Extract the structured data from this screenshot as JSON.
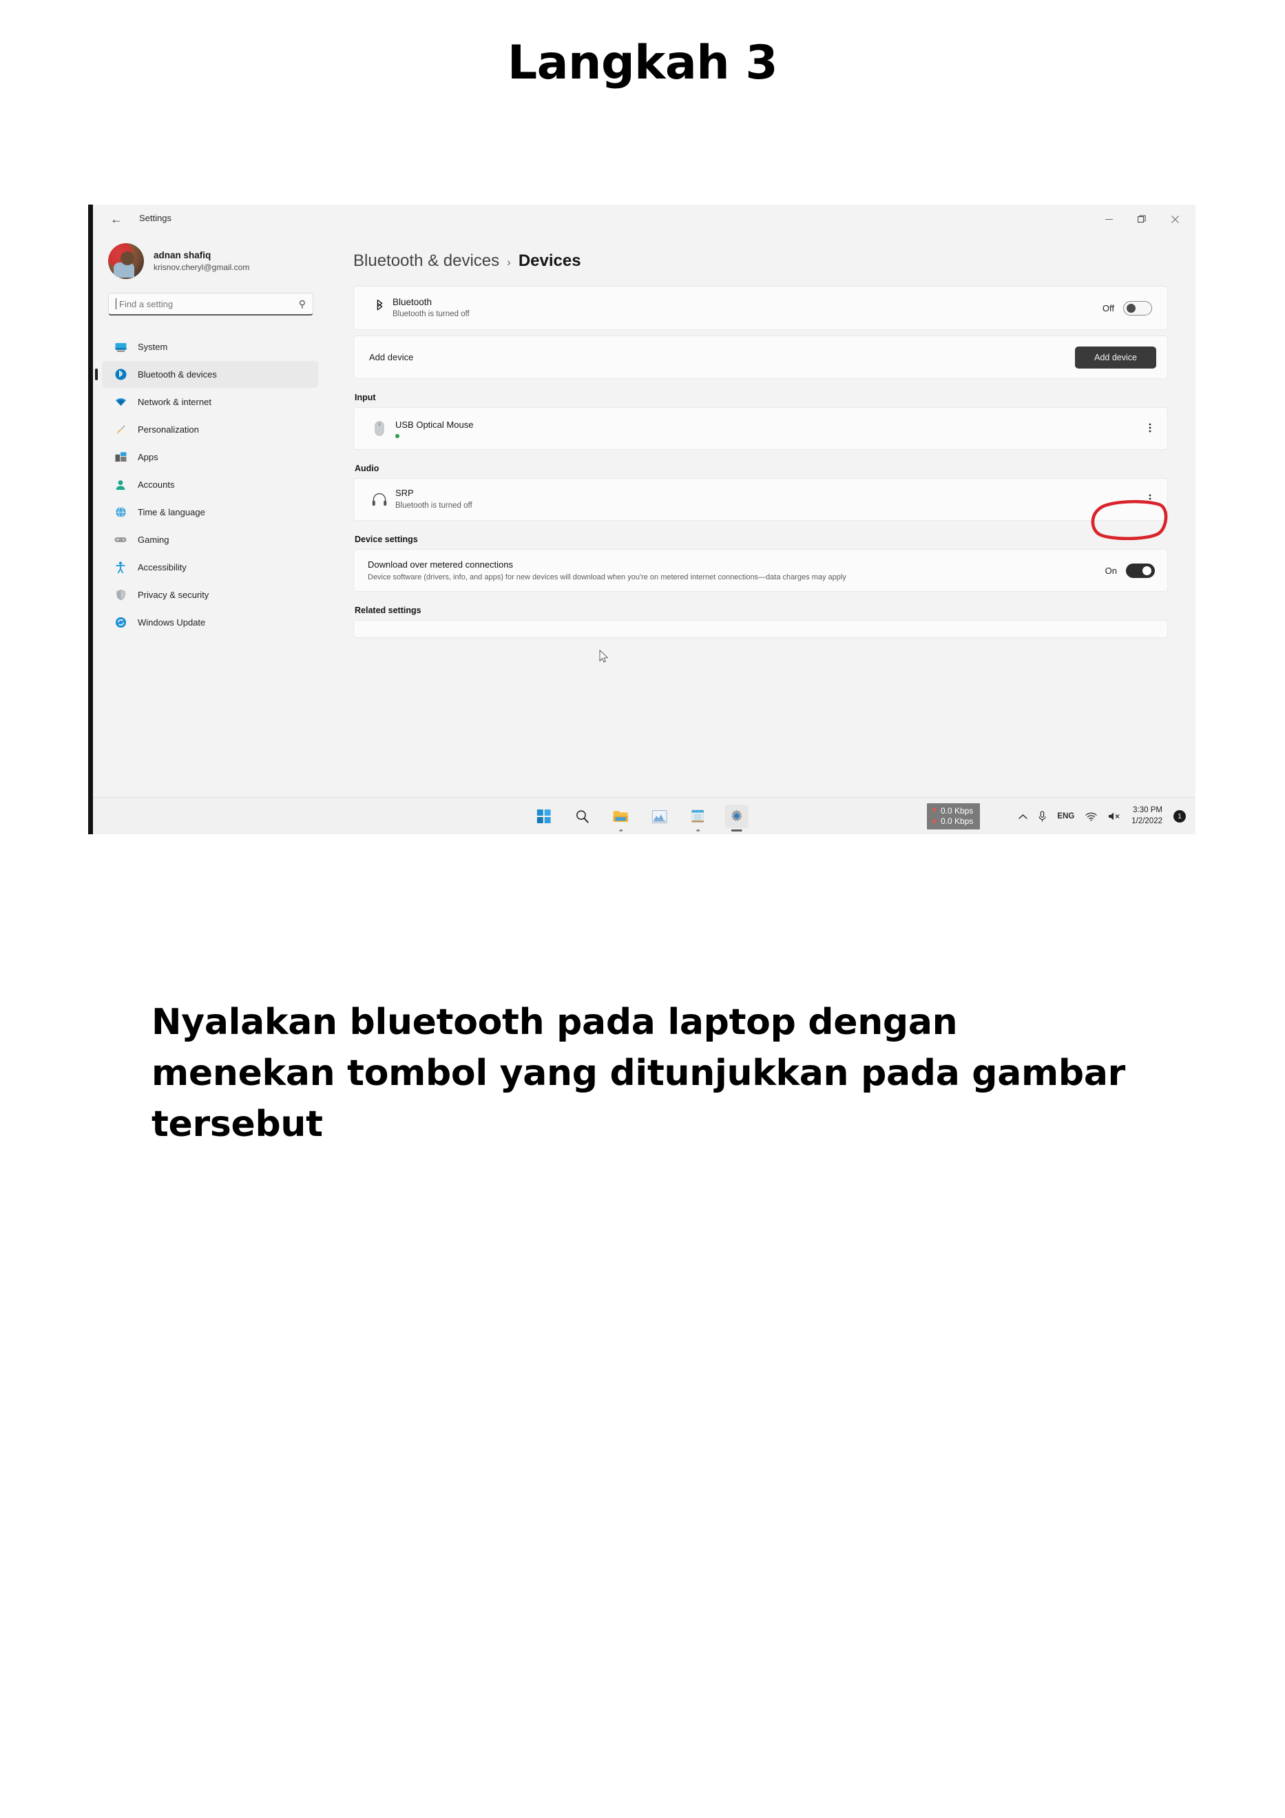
{
  "slide": {
    "title": "Langkah 3",
    "caption": "Nyalakan bluetooth pada laptop dengan menekan tombol yang ditunjukkan pada gambar tersebut"
  },
  "window": {
    "title": "Settings",
    "back_icon": "back-arrow-icon",
    "controls": {
      "minimize": "minimize-icon",
      "restore": "restore-icon",
      "close": "close-icon"
    }
  },
  "account": {
    "name": "adnan shafiq",
    "email": "krisnov.cheryl@gmail.com"
  },
  "search": {
    "placeholder": "Find a setting",
    "value": "",
    "icon": "search-icon"
  },
  "sidebar": {
    "items": [
      {
        "label": "System",
        "icon": "monitor-icon",
        "active": false
      },
      {
        "label": "Bluetooth & devices",
        "icon": "bluetooth-icon",
        "active": true
      },
      {
        "label": "Network & internet",
        "icon": "wifi-icon",
        "active": false
      },
      {
        "label": "Personalization",
        "icon": "paintbrush-icon",
        "active": false
      },
      {
        "label": "Apps",
        "icon": "apps-icon",
        "active": false
      },
      {
        "label": "Accounts",
        "icon": "person-icon",
        "active": false
      },
      {
        "label": "Time & language",
        "icon": "globe-clock-icon",
        "active": false
      },
      {
        "label": "Gaming",
        "icon": "gamepad-icon",
        "active": false
      },
      {
        "label": "Accessibility",
        "icon": "accessibility-icon",
        "active": false
      },
      {
        "label": "Privacy & security",
        "icon": "shield-icon",
        "active": false
      },
      {
        "label": "Windows Update",
        "icon": "update-icon",
        "active": false
      }
    ]
  },
  "breadcrumb": {
    "parent": "Bluetooth & devices",
    "separator": "›",
    "current": "Devices"
  },
  "bluetooth_card": {
    "icon": "bluetooth-icon",
    "title": "Bluetooth",
    "subtitle": "Bluetooth is turned off",
    "toggle_label": "Off",
    "toggle_state": "off",
    "annotated": true,
    "annotation_color": "#d9232a"
  },
  "add_device": {
    "label": "Add device",
    "button_label": "Add device"
  },
  "sections": [
    {
      "heading": "Input",
      "devices": [
        {
          "name": "USB Optical Mouse",
          "status": "",
          "status_dot": "#2e9e4f",
          "icon": "mouse-icon",
          "menu_icon": "kebab-menu-icon"
        }
      ]
    },
    {
      "heading": "Audio",
      "devices": [
        {
          "name": "SRP",
          "status": "Bluetooth is turned off",
          "status_dot": "",
          "icon": "headphones-icon",
          "menu_icon": "kebab-menu-icon"
        }
      ]
    }
  ],
  "device_settings": {
    "heading": "Device settings",
    "item_title": "Download over metered connections",
    "item_desc": "Device software (drivers, info, and apps) for new devices will download when you're on metered internet connections—data charges may apply",
    "toggle_label": "On",
    "toggle_state": "on"
  },
  "related_settings": {
    "heading": "Related settings"
  },
  "taskbar": {
    "icons": [
      {
        "name": "start-icon",
        "label": "Start"
      },
      {
        "name": "search-icon",
        "label": "Search"
      },
      {
        "name": "file-explorer-icon",
        "label": "File Explorer"
      },
      {
        "name": "chart-app-icon",
        "label": "Chart app"
      },
      {
        "name": "notepad-icon",
        "label": "Notepad"
      },
      {
        "name": "settings-gear-icon",
        "label": "Settings"
      }
    ],
    "network_speed": {
      "down": "0.0 Kbps",
      "up": "0.0 Kbps"
    },
    "tray": {
      "overflow_icon": "chevron-up-icon",
      "mic_icon": "microphone-icon",
      "language": "ENG",
      "wifi_icon": "wifi-icon",
      "volume_icon": "volume-muted-icon",
      "time": "3:30 PM",
      "date": "1/2/2022",
      "notification_count": "1"
    }
  }
}
